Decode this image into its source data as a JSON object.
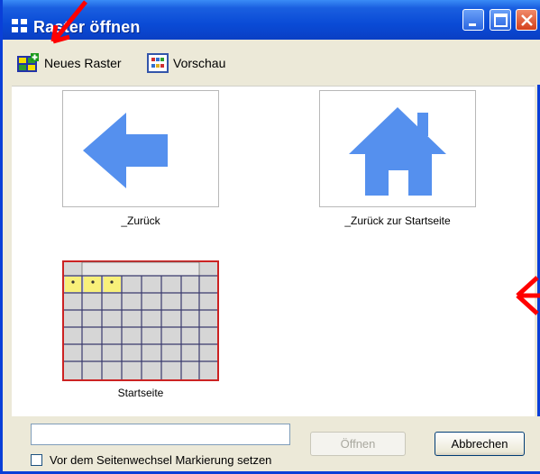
{
  "window": {
    "title": "Raster öffnen"
  },
  "toolbar": {
    "new_grid_label": "Neues Raster",
    "preview_label": "Vorschau"
  },
  "grids": [
    {
      "caption": "_Zurück",
      "icon": "back-arrow-icon"
    },
    {
      "caption": "_Zurück zur Startseite",
      "icon": "home-icon"
    },
    {
      "caption": "Startseite",
      "icon": "grid-thumbnail"
    }
  ],
  "footer": {
    "name_value": "",
    "open_label": "Öffnen",
    "cancel_label": "Abbrechen",
    "checkbox_label": "Vor dem Seitenwechsel Markierung setzen",
    "checkbox_checked": false
  },
  "colors": {
    "accent_blue": "#5590ee",
    "annotation_red": "#ff0000",
    "grid_border": "#cc2222"
  }
}
